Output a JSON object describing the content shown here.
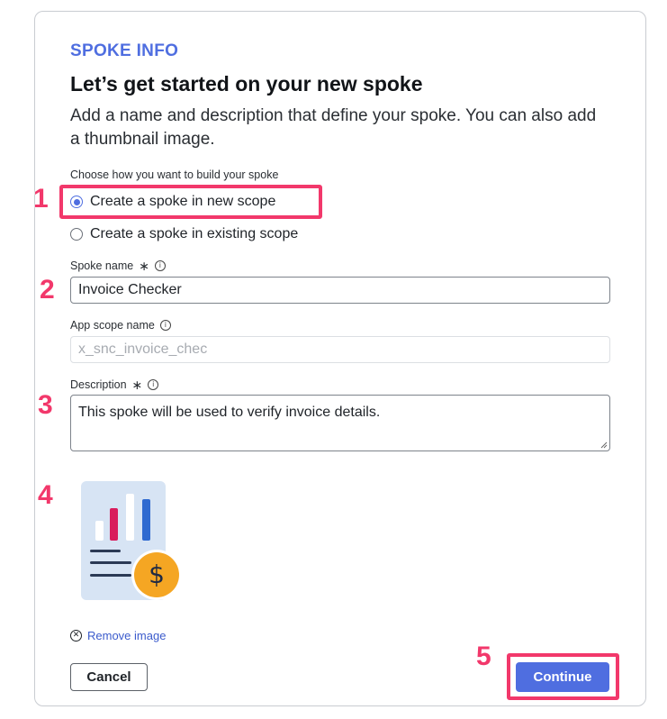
{
  "header": {
    "eyebrow": "SPOKE INFO",
    "title": "Let’s get started on your new spoke",
    "subtitle": "Add a name and description that define your spoke. You can also add a thumbnail image."
  },
  "build_choice": {
    "label": "Choose how you want to build your spoke",
    "options": [
      {
        "label": "Create a spoke in new scope",
        "checked": true
      },
      {
        "label": "Create a spoke in existing scope",
        "checked": false
      }
    ]
  },
  "spoke_name": {
    "label": "Spoke name",
    "required_mark": "∗",
    "value": "Invoice Checker"
  },
  "app_scope": {
    "label": "App scope name",
    "placeholder": "x_snc_invoice_chec"
  },
  "description": {
    "label": "Description",
    "required_mark": "∗",
    "value": "This spoke will be used to verify invoice details."
  },
  "thumbnail": {
    "alt": "invoice chart thumbnail",
    "remove_label": "Remove image"
  },
  "footer": {
    "cancel_label": "Cancel",
    "continue_label": "Continue"
  },
  "annotations": [
    "1",
    "2",
    "3",
    "4",
    "5"
  ],
  "colors": {
    "accent": "#4f6ee0",
    "highlight": "#f2386b"
  },
  "icons": {
    "info": "info-icon",
    "remove": "close-circle-icon"
  }
}
